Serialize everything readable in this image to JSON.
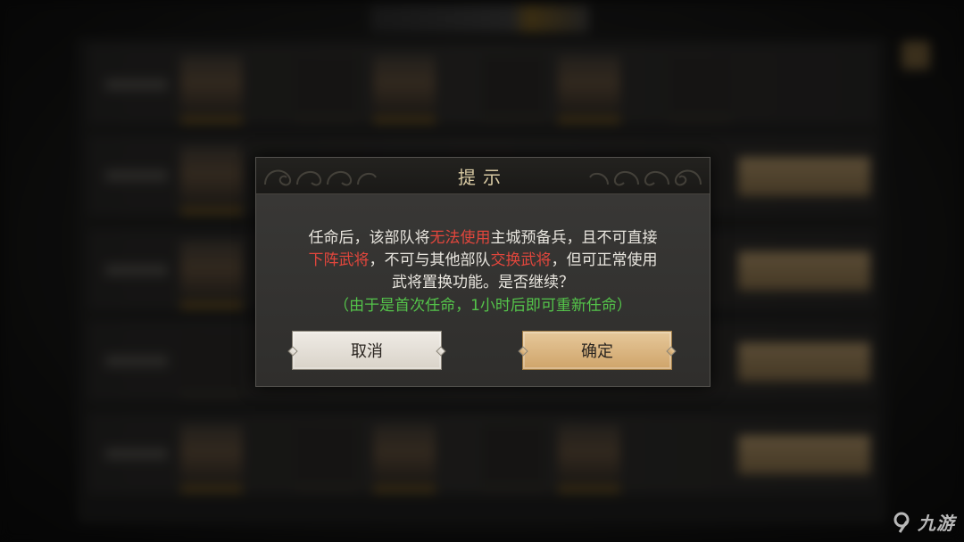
{
  "dialog": {
    "title": "提示",
    "message": {
      "line1_part1": "任命后，该部队将",
      "line1_red": "无法使用",
      "line1_part2": "主城预备兵，且不可直接",
      "line2_red1": "下阵武将",
      "line2_part": "，不可与其他部队",
      "line2_red2": "交换武将",
      "line2_part2": "，但可正常使用",
      "line3": "武将置换功能。是否继续？"
    },
    "note": "（由于是首次任命，1小时后即可重新任命）",
    "cancel_label": "取消",
    "confirm_label": "确定"
  },
  "watermark": {
    "text": "九游",
    "logo_icon": "nine-game-logo-icon"
  },
  "colors": {
    "warning_red": "#e2463c",
    "note_green": "#54c44a",
    "title_gold": "#d8c9a2",
    "confirm_gold": "#cfa46a"
  }
}
